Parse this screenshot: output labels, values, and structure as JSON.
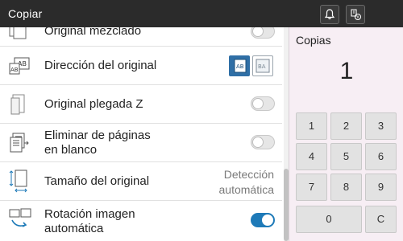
{
  "titlebar": {
    "title": "Copiar",
    "icons": [
      "bell-icon",
      "job-status-icon"
    ]
  },
  "list": {
    "items": [
      {
        "label1": "Original mezclado",
        "label2": "",
        "icon": "mixed-original-icon",
        "control": "toggle",
        "state": false
      },
      {
        "label1": "Dirección del original",
        "label2": "",
        "icon": "original-direction-icon",
        "control": "direction-buttons",
        "selected": "left"
      },
      {
        "label1": "Original plegada Z",
        "label2": "",
        "icon": "z-folded-icon",
        "control": "toggle",
        "state": false
      },
      {
        "label1": "Eliminar de páginas",
        "label2": "en blanco",
        "icon": "remove-blank-pages-icon",
        "control": "toggle",
        "state": false
      },
      {
        "label1": "Tamaño del original",
        "label2": "",
        "icon": "original-size-icon",
        "control": "value",
        "value1": "Detección",
        "value2": "automática"
      },
      {
        "label1": "Rotación imagen",
        "label2": "automática",
        "icon": "auto-rotation-icon",
        "control": "toggle",
        "state": true
      }
    ]
  },
  "panel": {
    "copies_label": "Copias",
    "copies_value": "1",
    "keys": [
      "1",
      "2",
      "3",
      "4",
      "5",
      "6",
      "7",
      "8",
      "9",
      "0",
      "C"
    ]
  },
  "colors": {
    "titlebar": "#2b2b2b",
    "accent": "#1e7ab8",
    "panel": "#f7eef4"
  }
}
